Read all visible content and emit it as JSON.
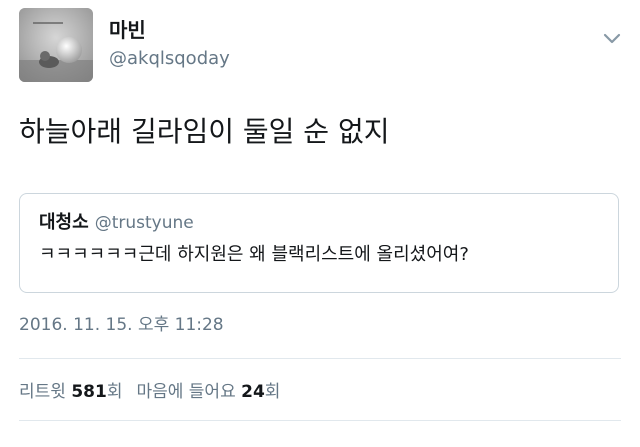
{
  "author": {
    "display_name": "마빈",
    "handle": "@akqlsqoday",
    "avatar_icon": "avatar-image"
  },
  "menu_icon": "chevron-down-icon",
  "tweet": {
    "text": "하늘아래 길라임이 둘일 순 없지",
    "timestamp": "2016. 11. 15. 오후 11:28"
  },
  "quoted_tweet": {
    "display_name": "대청소",
    "handle": "@trustyune",
    "text": "ㅋㅋㅋㅋㅋㅋ근데 하지원은 왜 블랙리스트에 올리셨어여?"
  },
  "stats": {
    "retweets_label": "리트윗",
    "retweets_count": "581",
    "retweets_suffix": "회",
    "likes_label": "마음에 들어요",
    "likes_count": "24",
    "likes_suffix": "회"
  },
  "colors": {
    "text_primary": "#14171a",
    "text_secondary": "#657786",
    "border": "#ccd6dd",
    "divider": "#e1e8ed"
  }
}
